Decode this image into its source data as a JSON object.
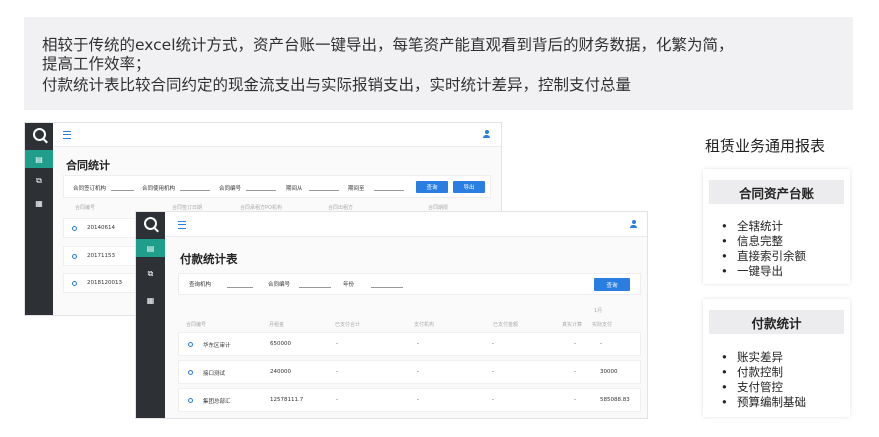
{
  "banner": {
    "lines": [
      "相较于传统的excel统计方式，资产台账一键导出，每笔资产能直观看到背后的财务数据，化繁为简，",
      "提高工作效率；",
      "付款统计表比较合同约定的现金流支出与实际报销支出，实时统计差异，控制支付总量"
    ]
  },
  "contract_window": {
    "title": "合同统计",
    "filters": [
      "合同签订机构",
      "合同使用机构",
      "合同编号",
      "期间从",
      "期间至"
    ],
    "buttons": [
      "查询",
      "导出"
    ],
    "columns": [
      "合同编号",
      "合同签订日期",
      "合同承租方PO机构",
      "合同出租方",
      "合同期限"
    ],
    "rows": [
      "20140614",
      "20171153",
      "2018120013"
    ]
  },
  "payment_window": {
    "title": "付款统计表",
    "filters": [
      "查询机构",
      "合同编号",
      "年份"
    ],
    "query_button": "查询",
    "month_label": "1月",
    "columns": [
      "合同编号",
      "月租金",
      "已支付合计",
      "支付机构",
      "已支付金额",
      "真实计算",
      "实际支付"
    ],
    "rows": [
      {
        "name": "华东区审计",
        "amount": "650000",
        "paid_total": "-",
        "org": "-",
        "paid": "-",
        "calc": "-",
        "actual": "-"
      },
      {
        "name": "接口测试",
        "amount": "240000",
        "paid_total": "-",
        "org": "-",
        "paid": "-",
        "calc": "-",
        "actual": "30000"
      },
      {
        "name": "集团总部汇",
        "amount": "12578111.7",
        "paid_total": "-",
        "org": "-",
        "paid": "-",
        "calc": "-",
        "actual": "585088.83"
      }
    ]
  },
  "right_panel": {
    "title": "租赁业务通用报表",
    "cards": [
      {
        "header": "合同资产台账",
        "items": [
          "全辖统计",
          "信息完整",
          "直接索引余额",
          "一键导出"
        ]
      },
      {
        "header": "付款统计",
        "items": [
          "账实差异",
          "付款控制",
          "支付管控",
          "预算编制基础"
        ]
      }
    ]
  },
  "icons": {
    "logo": "logo-ring-icon",
    "menu": "hamburger-menu-icon",
    "user": "user-icon",
    "accent": "#1f9e8b",
    "primary": "#2a7de1",
    "rail": "#2d3136"
  }
}
